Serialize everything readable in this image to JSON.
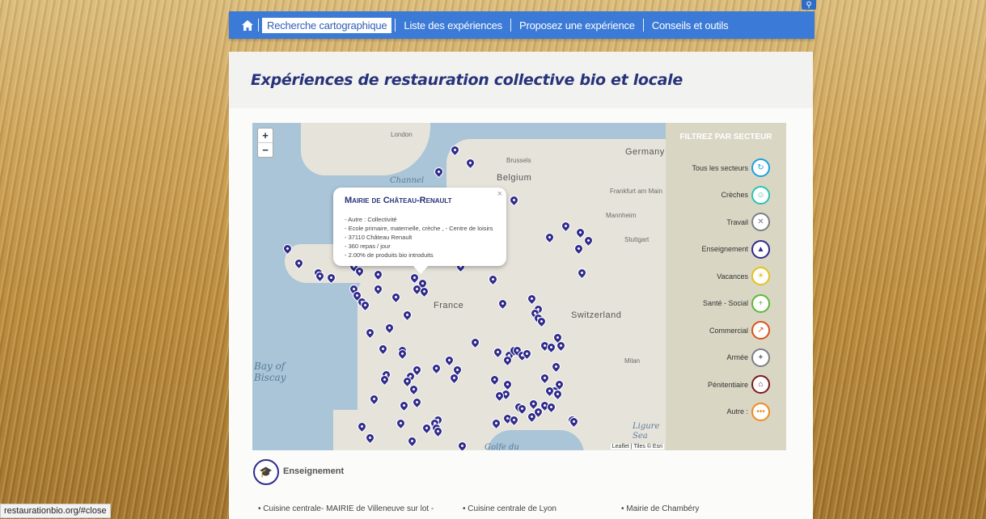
{
  "nav": {
    "items": [
      {
        "label": "Recherche cartographique",
        "active": true
      },
      {
        "label": "Liste des expériences",
        "active": false
      },
      {
        "label": "Proposez une expérience",
        "active": false
      },
      {
        "label": "Conseils et outils",
        "active": false
      }
    ],
    "home_icon": "home-icon",
    "search_icon": "search-icon"
  },
  "page": {
    "title": "Expériences de restauration collective bio et locale"
  },
  "map": {
    "labels": {
      "london": "London",
      "brussels": "Brussels",
      "belgium": "Belgium",
      "germany": "Germany",
      "frankfurt": "Frankfurt am Main",
      "mannheim": "Mannheim",
      "stuttgart": "Stuttgart",
      "france": "France",
      "switzerland": "Switzerland",
      "milan": "Milan",
      "bay": "Bay of",
      "biscay": "Biscay",
      "ligure": "Ligure",
      "sea": "Sea",
      "channel": "Channel",
      "golfe": "Golfe du"
    },
    "zoom_in": "+",
    "zoom_out": "−",
    "attribution": "Leaflet | Tiles © Esri",
    "popup": {
      "title": "Mairie de Château-Renault",
      "close": "×",
      "lines": [
        "- Autre : Collectivité",
        "- Ecole primaire, maternelle, crèche , - Centre de loisirs",
        "- 37110 Château Renault",
        "- 360 repas / jour",
        "- 2.00% de produits bio introduits"
      ]
    }
  },
  "filter": {
    "heading": "FILTREZ PAR SECTEUR",
    "items": [
      {
        "label": "Tous les secteurs",
        "color": "#1e9fe0",
        "icon": "refresh-icon",
        "glyph": "↻"
      },
      {
        "label": "Crèches",
        "color": "#2cc3b0",
        "icon": "stroller-icon",
        "glyph": "☺"
      },
      {
        "label": "Travail",
        "color": "#7b7f86",
        "icon": "tools-icon",
        "glyph": "✕"
      },
      {
        "label": "Enseignement",
        "color": "#302b8c",
        "icon": "graduation-cap-icon",
        "glyph": "▲"
      },
      {
        "label": "Vacances",
        "color": "#e4c21a",
        "icon": "beach-icon",
        "glyph": "☀"
      },
      {
        "label": "Santé - Social",
        "color": "#5cb83a",
        "icon": "medical-icon",
        "glyph": "+"
      },
      {
        "label": "Commercial",
        "color": "#d9531e",
        "icon": "chart-icon",
        "glyph": "↗"
      },
      {
        "label": "Armée",
        "color": "#7b7f86",
        "icon": "soldier-icon",
        "glyph": "✦"
      },
      {
        "label": "Pénitentiaire",
        "color": "#7a1a1a",
        "icon": "prison-icon",
        "glyph": "⌂"
      },
      {
        "label": "Autre :",
        "color": "#f08a1e",
        "icon": "more-icon",
        "glyph": "•••"
      }
    ]
  },
  "section": {
    "title": "Enseignement",
    "icon": "graduation-cap-icon",
    "items": [
      "Cuisine centrale- MAIRIE de Villeneuve sur lot -",
      "Cuisine centrale de Lyon",
      "Mairie de Chambéry"
    ]
  },
  "status_url": "restaurationbio.org/#close"
}
